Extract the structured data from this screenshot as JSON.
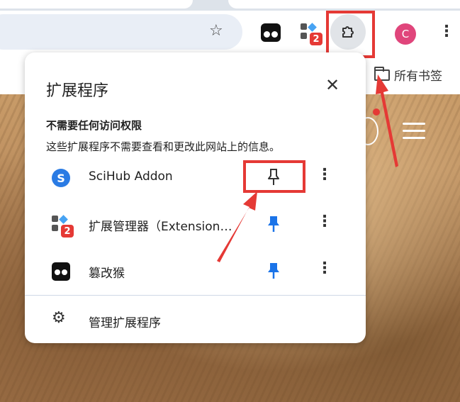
{
  "toolbar": {
    "avatar_letter": "C",
    "ext_badge": "2",
    "bookmarks_label": "所有书签"
  },
  "popup": {
    "title": "扩展程序",
    "section_title": "不需要任何访问权限",
    "section_desc": "这些扩展程序不需要查看和更改此网站上的信息。",
    "items": [
      {
        "label": "SciHub Addon",
        "icon": "scihub-icon",
        "pinned": false
      },
      {
        "label": "扩展管理器（Extension…",
        "icon": "extension-manager-icon",
        "badge": "2",
        "pinned": true
      },
      {
        "label": "篡改猴",
        "icon": "tampermonkey-icon",
        "pinned": true
      }
    ],
    "manage_label": "管理扩展程序"
  },
  "colors": {
    "accent_blue": "#1a73e8",
    "annotation_red": "#e53935",
    "avatar": "#e0457b"
  }
}
